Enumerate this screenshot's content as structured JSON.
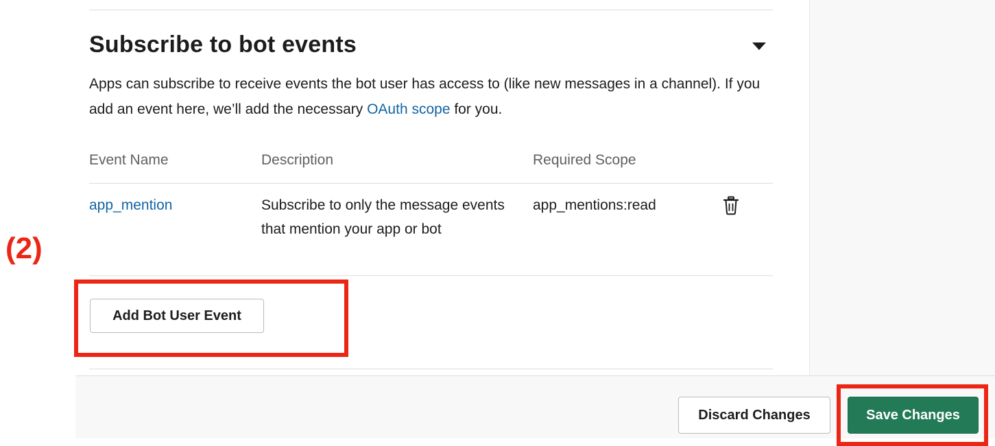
{
  "section": {
    "title": "Subscribe to bot events",
    "description_before_link": "Apps can subscribe to receive events the bot user has access to (like new messages in a channel). If you add an event here, we’ll add the necessary ",
    "description_link": "OAuth scope",
    "description_after_link": " for you."
  },
  "table": {
    "headers": [
      "Event Name",
      "Description",
      "Required Scope"
    ],
    "rows": [
      {
        "event_name": "app_mention",
        "description": "Subscribe to only the message events that mention your app or bot",
        "required_scope": "app_mentions:read"
      }
    ]
  },
  "buttons": {
    "add_bot_user_event": "Add Bot User Event",
    "discard_changes": "Discard Changes",
    "save_changes": "Save Changes"
  },
  "annotation": {
    "label": "(2)",
    "color": "#ec2614"
  },
  "colors": {
    "link": "#1264a3",
    "primary_button": "#237a57",
    "annotation_red": "#ec2614"
  },
  "icons": {
    "collapse": "caret-down-icon",
    "delete": "trash-icon"
  }
}
